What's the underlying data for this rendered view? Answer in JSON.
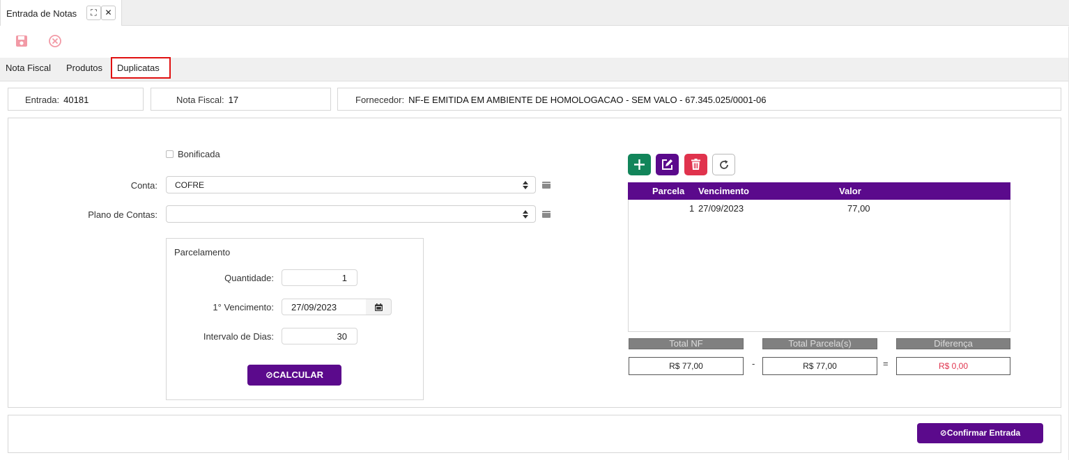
{
  "window": {
    "tab_title": "Entrada de Notas",
    "maximize_icon": "⛶",
    "close_icon": "✕"
  },
  "toolbar": {
    "save_icon": "save-icon",
    "cancel_icon": "cancel-icon"
  },
  "tabs": [
    {
      "label": "Nota Fiscal"
    },
    {
      "label": "Produtos"
    },
    {
      "label": "Duplicatas"
    }
  ],
  "header": {
    "entrada_label": "Entrada:",
    "entrada_value": "40181",
    "nota_fiscal_label": "Nota Fiscal:",
    "nota_fiscal_value": "17",
    "fornecedor_label": "Fornecedor:",
    "fornecedor_value": "NF-E EMITIDA EM AMBIENTE DE HOMOLOGACAO - SEM VALO - 67.345.025/0001-06"
  },
  "form": {
    "bonificada_label": "Bonificada",
    "conta_label": "Conta:",
    "conta_value": "COFRE",
    "plano_label": "Plano de Contas:",
    "plano_value": ""
  },
  "parcelamento": {
    "title": "Parcelamento",
    "quantidade_label": "Quantidade:",
    "quantidade_value": "1",
    "vencimento_label": "1°  Vencimento:",
    "vencimento_value": "27/09/2023",
    "intervalo_label": "Intervalo de Dias:",
    "intervalo_value": "30",
    "calcular_label": "⊘CALCULAR"
  },
  "grid": {
    "columns": [
      "Parcela",
      "Vencimento",
      "Valor"
    ],
    "rows": [
      {
        "parcela": "1",
        "vencimento": "27/09/2023",
        "valor": "77,00"
      }
    ]
  },
  "totals": {
    "total_nf_label": "Total NF",
    "total_nf_value": "R$ 77,00",
    "total_parcelas_label": "Total Parcela(s)",
    "total_parcelas_value": "R$ 77,00",
    "diferenca_label": "Diferença",
    "diferenca_value": "R$ 0,00",
    "minus": "-",
    "equals": "="
  },
  "footer": {
    "confirm_label": "⊘Confirmar Entrada"
  },
  "colors": {
    "accent": "#5b0a8c",
    "add": "#12855a",
    "delete": "#e0334d",
    "highlight_border": "#e01010"
  }
}
